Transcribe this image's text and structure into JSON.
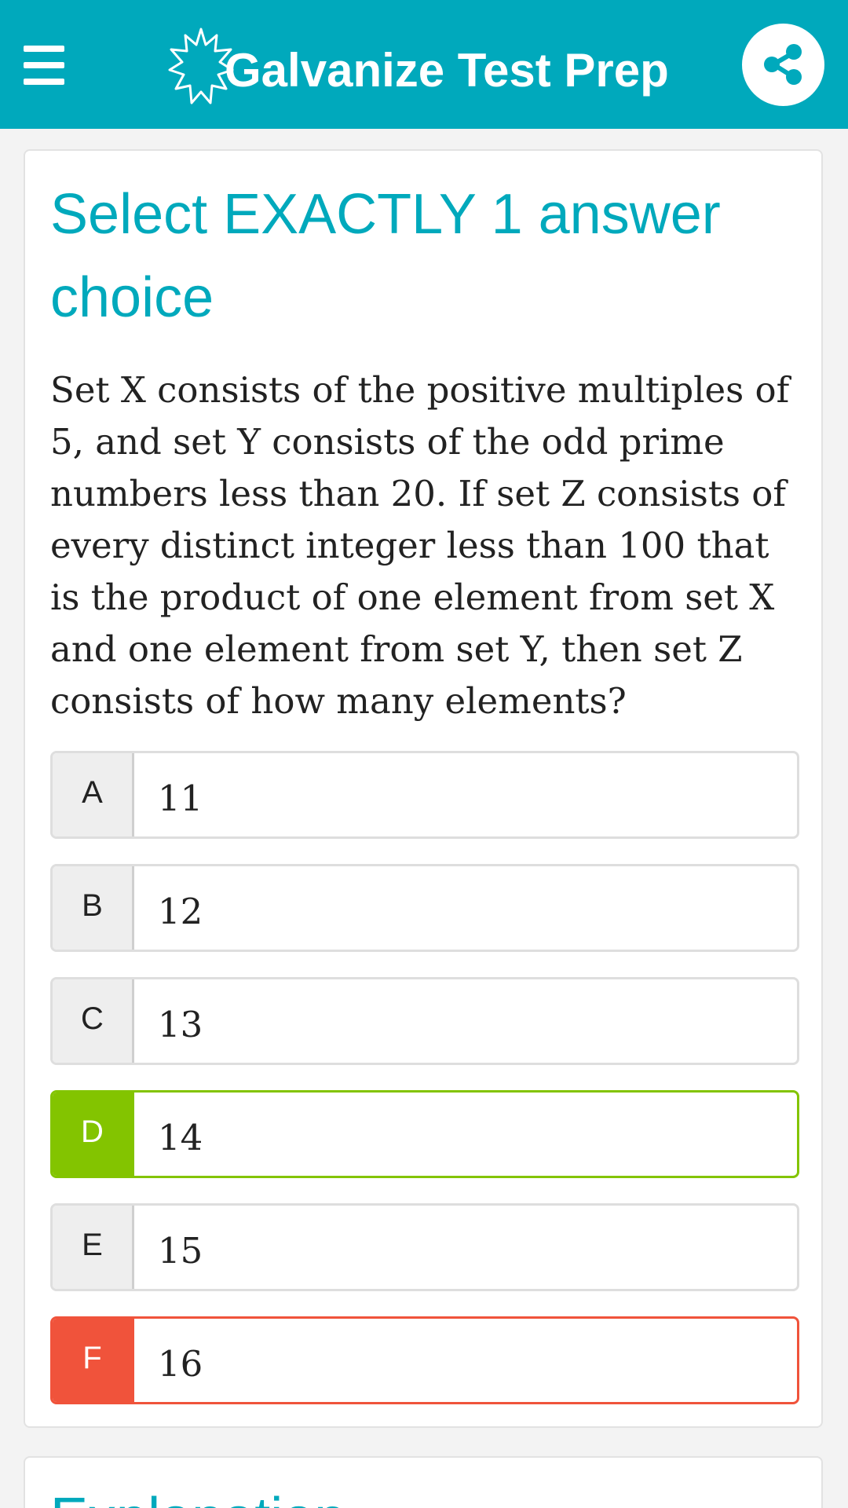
{
  "header": {
    "title": "Galvanize Test Prep",
    "background": "#00a9bc",
    "menu_icon": "hamburger-menu-icon",
    "share_icon": "share-icon"
  },
  "question_card": {
    "instruction": "Select EXACTLY 1 answer choice",
    "question": "Set X consists of the positive multiples of 5, and set Y consists of the odd prime numbers less than 20. If set Z consists of every distinct integer less than 100 that is the product of one element from set X and one element from set Y, then set Z consists of how many elements?",
    "choices": [
      {
        "letter": "A",
        "value": "11",
        "state": "default"
      },
      {
        "letter": "B",
        "value": "12",
        "state": "default"
      },
      {
        "letter": "C",
        "value": "13",
        "state": "default"
      },
      {
        "letter": "D",
        "value": "14",
        "state": "correct"
      },
      {
        "letter": "E",
        "value": "15",
        "state": "default"
      },
      {
        "letter": "F",
        "value": "16",
        "state": "incorrect"
      }
    ]
  },
  "explanation_card": {
    "title": "Explanation"
  },
  "colors": {
    "accent": "#00a9bc",
    "correct": "#83c400",
    "incorrect": "#f0533b"
  }
}
